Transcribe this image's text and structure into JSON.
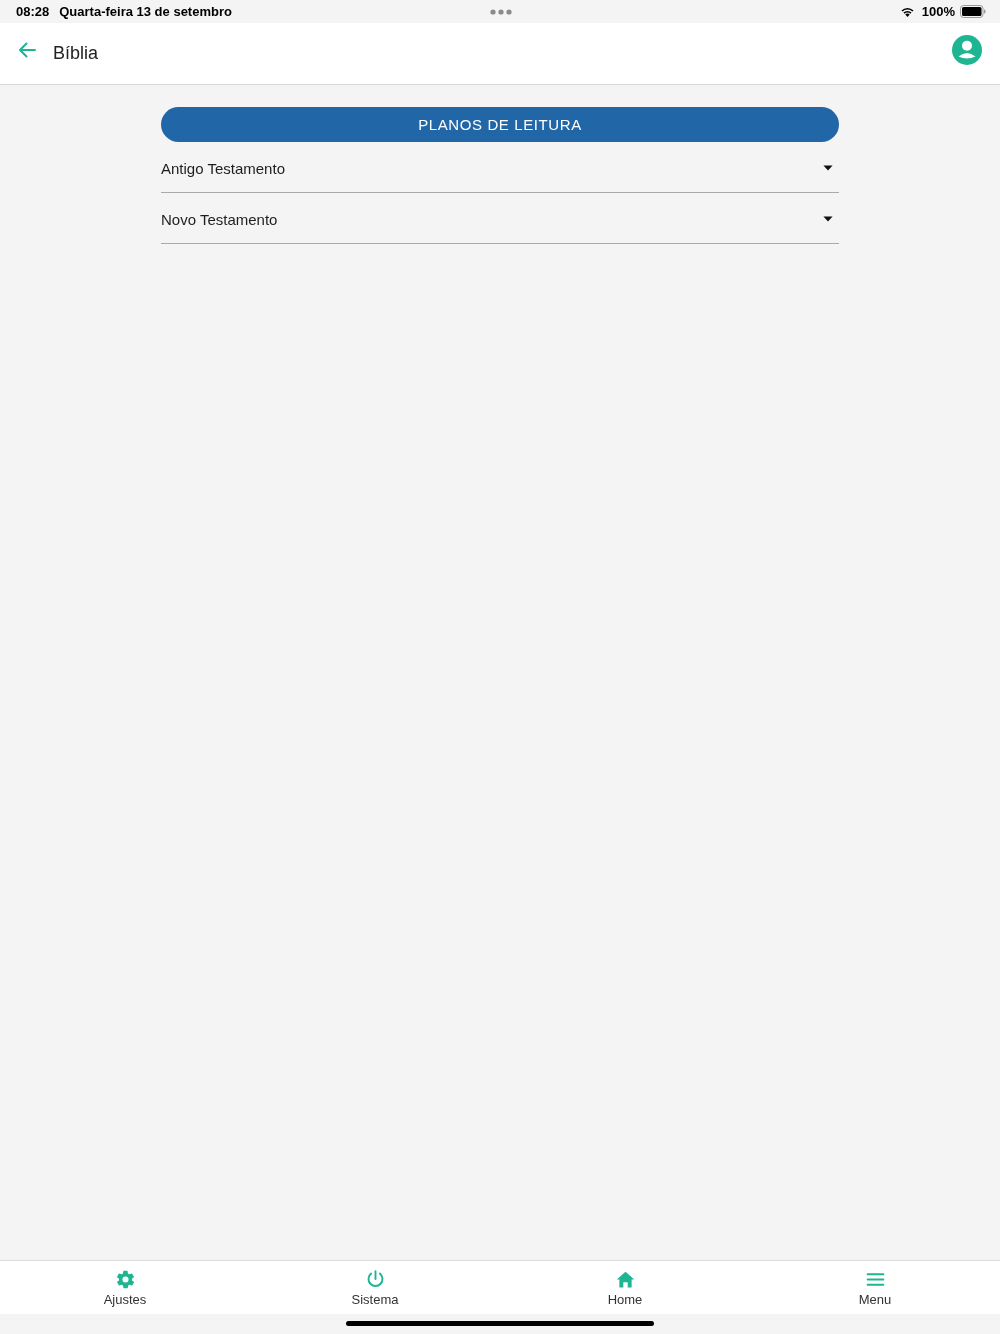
{
  "status_bar": {
    "time": "08:28",
    "date": "Quarta-feira 13 de setembro",
    "battery": "100%"
  },
  "header": {
    "title": "Bíblia"
  },
  "primary_button": {
    "label": "PLANOS DE LEITURA"
  },
  "sections": [
    {
      "label": "Antigo Testamento",
      "expanded": false
    },
    {
      "label": "Novo Testamento",
      "expanded": false
    }
  ],
  "tab_bar": [
    {
      "label": "Ajustes",
      "kind": "gear"
    },
    {
      "label": "Sistema",
      "kind": "power"
    },
    {
      "label": "Home",
      "kind": "home"
    },
    {
      "label": "Menu",
      "kind": "menu"
    }
  ]
}
